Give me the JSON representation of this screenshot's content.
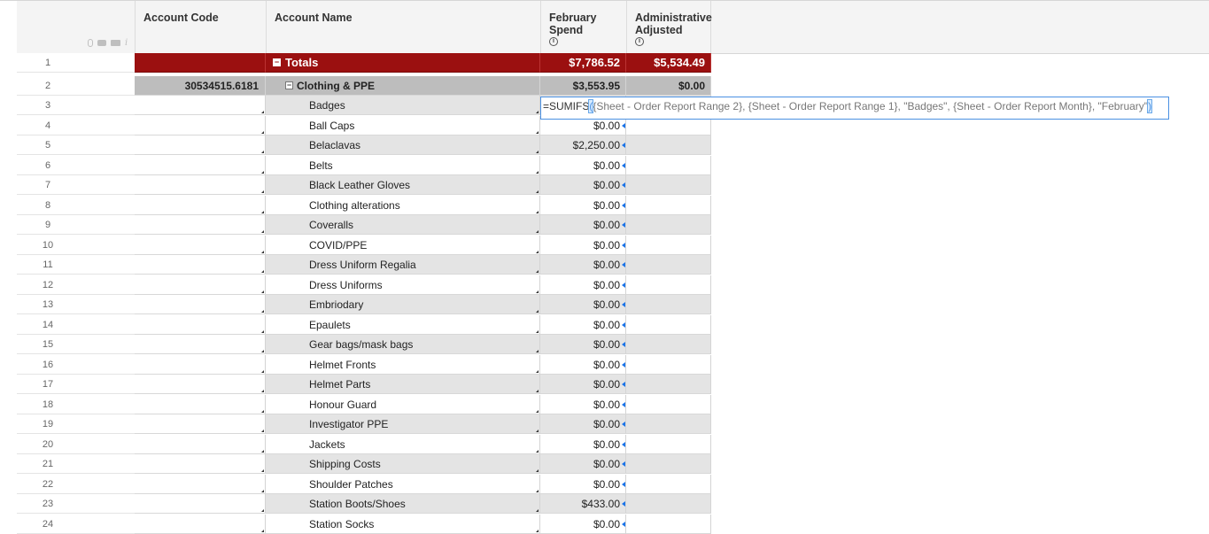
{
  "header": {
    "columns": [
      {
        "key": "account_code",
        "label": "Account Code",
        "info": false
      },
      {
        "key": "account_name",
        "label": "Account Name",
        "info": false
      },
      {
        "key": "february_spend",
        "label": "February Spend",
        "info": true
      },
      {
        "key": "administrative_adjusted",
        "label": "Administrative Adjusted",
        "info": true
      }
    ],
    "icons": [
      "attachment-icon",
      "comment-icon",
      "proof-icon",
      "info-italic-icon"
    ],
    "info_glyph": "i",
    "italic_glyph": "i"
  },
  "totals": {
    "row": "1",
    "name": "Totals",
    "feb": "$7,786.52",
    "adm": "$5,534.49",
    "locked": true
  },
  "group": {
    "row": "2",
    "code": "30534515.6181",
    "name": "Clothing & PPE",
    "feb": "$3,553.95",
    "adm": "$0.00"
  },
  "rows": [
    {
      "row": "3",
      "name": "Badges",
      "feb": "",
      "adm": ""
    },
    {
      "row": "4",
      "name": "Ball Caps",
      "feb": "$0.00",
      "adm": ""
    },
    {
      "row": "5",
      "name": "Belaclavas",
      "feb": "$2,250.00",
      "adm": ""
    },
    {
      "row": "6",
      "name": "Belts",
      "feb": "$0.00",
      "adm": ""
    },
    {
      "row": "7",
      "name": "Black Leather Gloves",
      "feb": "$0.00",
      "adm": ""
    },
    {
      "row": "8",
      "name": "Clothing alterations",
      "feb": "$0.00",
      "adm": ""
    },
    {
      "row": "9",
      "name": "Coveralls",
      "feb": "$0.00",
      "adm": ""
    },
    {
      "row": "10",
      "name": "COVID/PPE",
      "feb": "$0.00",
      "adm": ""
    },
    {
      "row": "11",
      "name": "Dress Uniform Regalia",
      "feb": "$0.00",
      "adm": ""
    },
    {
      "row": "12",
      "name": "Dress Uniforms",
      "feb": "$0.00",
      "adm": ""
    },
    {
      "row": "13",
      "name": "Embriodary",
      "feb": "$0.00",
      "adm": ""
    },
    {
      "row": "14",
      "name": "Epaulets",
      "feb": "$0.00",
      "adm": ""
    },
    {
      "row": "15",
      "name": "Gear bags/mask bags",
      "feb": "$0.00",
      "adm": ""
    },
    {
      "row": "16",
      "name": "Helmet Fronts",
      "feb": "$0.00",
      "adm": ""
    },
    {
      "row": "17",
      "name": "Helmet Parts",
      "feb": "$0.00",
      "adm": ""
    },
    {
      "row": "18",
      "name": "Honour Guard",
      "feb": "$0.00",
      "adm": ""
    },
    {
      "row": "19",
      "name": "Investigator PPE",
      "feb": "$0.00",
      "adm": ""
    },
    {
      "row": "20",
      "name": "Jackets",
      "feb": "$0.00",
      "adm": ""
    },
    {
      "row": "21",
      "name": "Shipping Costs",
      "feb": "$0.00",
      "adm": ""
    },
    {
      "row": "22",
      "name": "Shoulder Patches",
      "feb": "$0.00",
      "adm": ""
    },
    {
      "row": "23",
      "name": "Station Boots/Shoes",
      "feb": "$433.00",
      "adm": ""
    },
    {
      "row": "24",
      "name": "Station Socks",
      "feb": "$0.00",
      "adm": ""
    }
  ],
  "formula_editor": {
    "prefix": "=SUMIFS",
    "open_paren": "(",
    "args": "{Sheet - Order Report Range 2}, {Sheet - Order Report Range 1}, \"Badges\", {Sheet - Order Report Month}, \"February\"",
    "close_paren": ")"
  },
  "glyphs": {
    "collapse": "−"
  },
  "colors": {
    "totals_bg": "#9b1010",
    "group_bg": "#bdbdbd",
    "alt_row_bg": "#e4e4e4",
    "accent": "#1a73e8"
  }
}
